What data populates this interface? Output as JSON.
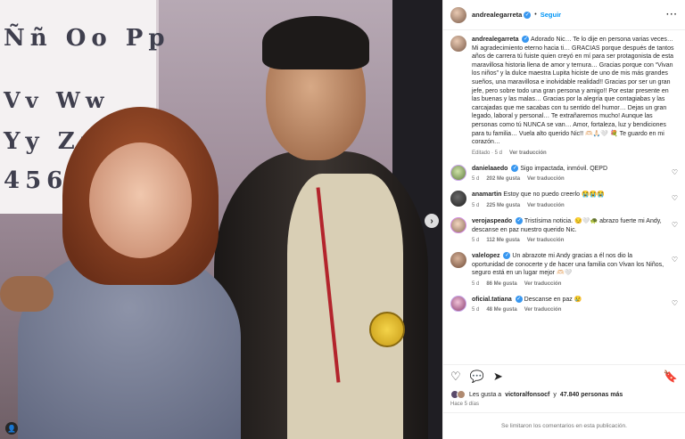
{
  "post": {
    "username": "andrealegarreta",
    "follow_label": "Seguir",
    "dot": "•",
    "more": "···"
  },
  "photo": {
    "board_rows": [
      "Ññ Oo Pp",
      "Vv Ww",
      "Yy Zz",
      "4567"
    ],
    "next_arrow": "›",
    "tag_icon": "👤"
  },
  "caption": {
    "username": "andrealegarreta",
    "text": "Adorado Nic… Te lo dije en persona varias veces… Mi agradecimiento eterno hacia ti… GRACIAS porque después de tantos años de carrera tú fuiste quien creyó en mí para ser protagonista de esta maravillosa historia llena de amor y ternura… Gracias porque con “Vivan los niños” y la dulce maestra Lupita hiciste de uno de mis más grandes sueños, una maravillosa e inolvidable realidad!! Gracias por ser un gran jefe, pero sobre todo una gran persona y amigo!! Por estar presente en las buenas y las malas… Gracias por la alegría que contagiabas y las carcajadas que me sacabas con tu sentido del humor… Dejas un gran legado, laboral y personal… Te extrañaremos mucho! Aunque las personas como tú NUNCA se van… Amor, fortaleza, luz y bendiciones para tu familia… Vuela alto querido Nic!! 🫶🏻🙏🏻🤍 💐 Te guardo en mi corazón…",
    "edited": "Editado · 5 d",
    "translation": "Ver traducción"
  },
  "comments": [
    {
      "user": "danielaaedo",
      "verified": true,
      "text": "Sigo impactada, inmóvil. QEPD",
      "age": "5 d",
      "likes": "202 Me gusta",
      "translation": "Ver traducción",
      "avatar": "av-daniela"
    },
    {
      "user": "anamartin",
      "verified": false,
      "text": "Estoy que no puedo creerlo 😭😭😭",
      "age": "5 d",
      "likes": "225 Me gusta",
      "translation": "Ver traducción",
      "avatar": "av-ana"
    },
    {
      "user": "verojaspeado",
      "verified": true,
      "text": "Tristísima noticia. 😔🤍🐢 abrazo fuerte mi Andy, descanse en paz nuestro querido Nic.",
      "age": "5 d",
      "likes": "112 Me gusta",
      "translation": "Ver traducción",
      "avatar": "av-vero"
    },
    {
      "user": "valelopez",
      "verified": true,
      "text": "Un abrazote mi Andy gracias a él nos dio la oportunidad de conocerte y de hacer una familia con Vivan los Niños, seguro está en un lugar mejor 🫶🏻🤍",
      "age": "5 d",
      "likes": "86 Me gusta",
      "translation": "Ver traducción",
      "avatar": "av-vale"
    },
    {
      "user": "oficial.tatiana",
      "verified": true,
      "text": "Descanse en paz 😢",
      "age": "5 d",
      "likes": "48 Me gusta",
      "translation": "Ver traducción",
      "avatar": "av-tatiana"
    }
  ],
  "actions": {
    "heart": "♡",
    "comment": "💬",
    "share": "➤",
    "save": "🔖"
  },
  "likes": {
    "prefix": "Les gusta a",
    "user": "victoralfonsocf",
    "middle": "y",
    "count": "47.840 personas más"
  },
  "date": "Hace 5 días",
  "footer": "Se limitaron los comentarios en esta publicación.",
  "colors": {
    "accent": "#0095f6",
    "verified": "#3897f0",
    "muted": "#737373"
  }
}
